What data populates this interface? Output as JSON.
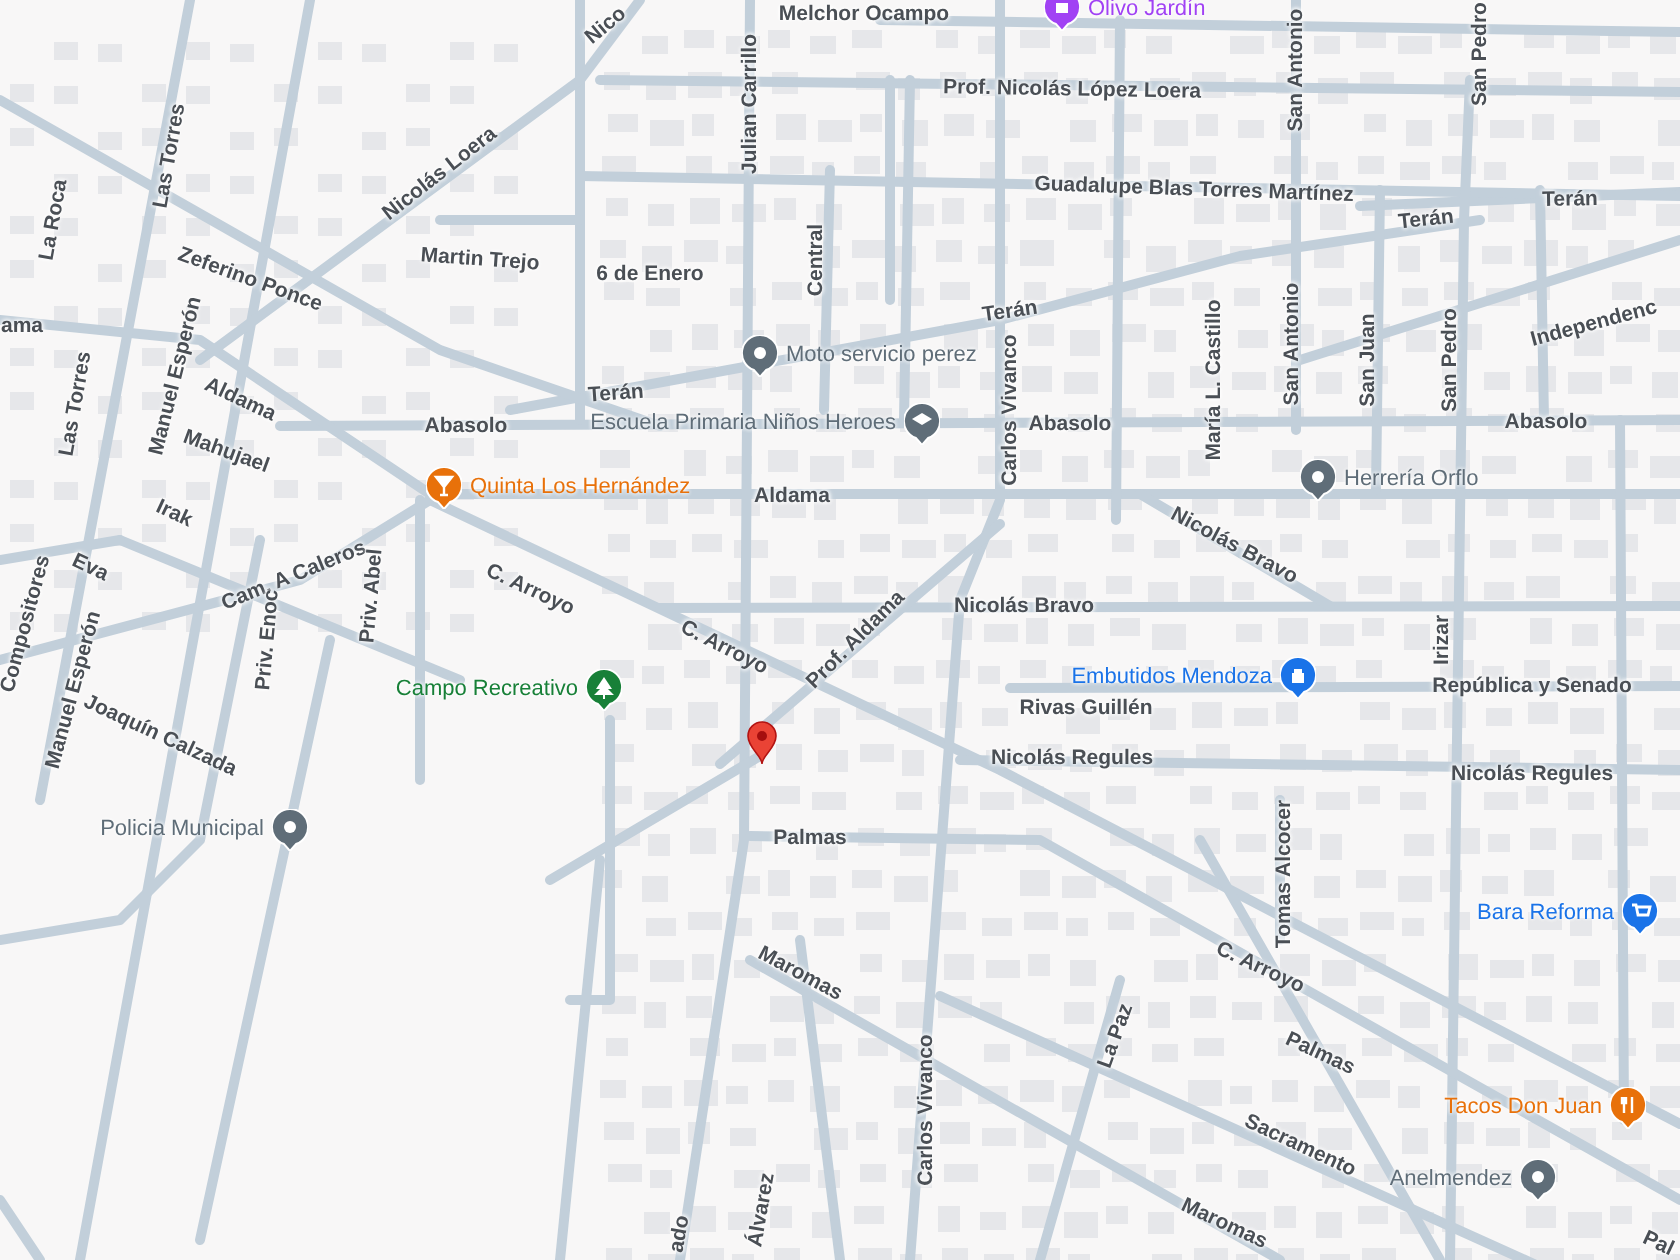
{
  "map": {
    "street_labels": [
      {
        "text": "Melchor Ocampo"
      },
      {
        "text": "Nico"
      },
      {
        "text": "Las Torres"
      },
      {
        "text": "La Roca"
      },
      {
        "text": "Zeferino Ponce"
      },
      {
        "text": "Nicolás Loera"
      },
      {
        "text": "Martin Trejo"
      },
      {
        "text": "6 de Enero"
      },
      {
        "text": "Julian Carrillo"
      },
      {
        "text": "Central"
      },
      {
        "text": "Prof. Nicolás López Loera"
      },
      {
        "text": "Guadalupe Blas Torres Martínez"
      },
      {
        "text": "Terán"
      },
      {
        "text": "Terán"
      },
      {
        "text": "Terán"
      },
      {
        "text": "Terán"
      },
      {
        "text": "San Antonio"
      },
      {
        "text": "San Pedro"
      },
      {
        "text": "ama"
      },
      {
        "text": "Las Torres"
      },
      {
        "text": "Manuel Esperón"
      },
      {
        "text": "Aldama"
      },
      {
        "text": "Mahujael"
      },
      {
        "text": "Abasolo"
      },
      {
        "text": "Abasolo"
      },
      {
        "text": "Abasolo"
      },
      {
        "text": "Carlos Vivanco"
      },
      {
        "text": "San Antonio"
      },
      {
        "text": "San Pedro"
      },
      {
        "text": "María L. Castillo"
      },
      {
        "text": "San Juan"
      },
      {
        "text": "Independenc"
      },
      {
        "text": "Aldama"
      },
      {
        "text": "Nicolás Bravo"
      },
      {
        "text": "Nicolás Bravo"
      },
      {
        "text": "Irak"
      },
      {
        "text": "Cam. A Caleros"
      },
      {
        "text": "Priv. Abel"
      },
      {
        "text": "C. Arroyo"
      },
      {
        "text": "C. Arroyo"
      },
      {
        "text": "Eva"
      },
      {
        "text": "Compositores"
      },
      {
        "text": "Manuel Esperón"
      },
      {
        "text": "Priv. Enoc"
      },
      {
        "text": "Joaquín Calzada"
      },
      {
        "text": "Prof. Aldama"
      },
      {
        "text": "Rivas Guillén"
      },
      {
        "text": "República y Senado"
      },
      {
        "text": "Irizar"
      },
      {
        "text": "Nicolás Regules"
      },
      {
        "text": "Nicolás Regules"
      },
      {
        "text": "Palmas"
      },
      {
        "text": "Tomas Alcocer"
      },
      {
        "text": "C. Arroyo"
      },
      {
        "text": "Maromas"
      },
      {
        "text": "Palmas"
      },
      {
        "text": "La Paz"
      },
      {
        "text": "Sacramento"
      },
      {
        "text": "Maromas"
      },
      {
        "text": "Carlos Vivanco"
      },
      {
        "text": "Álvarez"
      },
      {
        "text": "ado"
      },
      {
        "text": "Pal"
      }
    ],
    "places": [
      {
        "name": "Olivo Jardín",
        "kind": "shopping",
        "color": "#a142f4"
      },
      {
        "name": "Moto servicio perez",
        "kind": "generic",
        "color": "#5f6d78"
      },
      {
        "name": "Escuela Primaria Niños Heroes",
        "kind": "school",
        "color": "#5f6d78"
      },
      {
        "name": "Quinta Los Hernández",
        "kind": "bar",
        "color": "#e8710a"
      },
      {
        "name": "Herrería Orflo",
        "kind": "generic",
        "color": "#5f6d78"
      },
      {
        "name": "Campo Recreativo",
        "kind": "park",
        "color": "#188038"
      },
      {
        "name": "Embutidos Mendoza",
        "kind": "shop",
        "color": "#1a73e8"
      },
      {
        "name": "Policia Municipal",
        "kind": "generic",
        "color": "#5f6d78"
      },
      {
        "name": "Bara Reforma",
        "kind": "cart",
        "color": "#1a73e8"
      },
      {
        "name": "Tacos Don Juan",
        "kind": "food",
        "color": "#e8710a"
      },
      {
        "name": "Anelmendez",
        "kind": "generic",
        "color": "#5f6d78"
      }
    ]
  }
}
